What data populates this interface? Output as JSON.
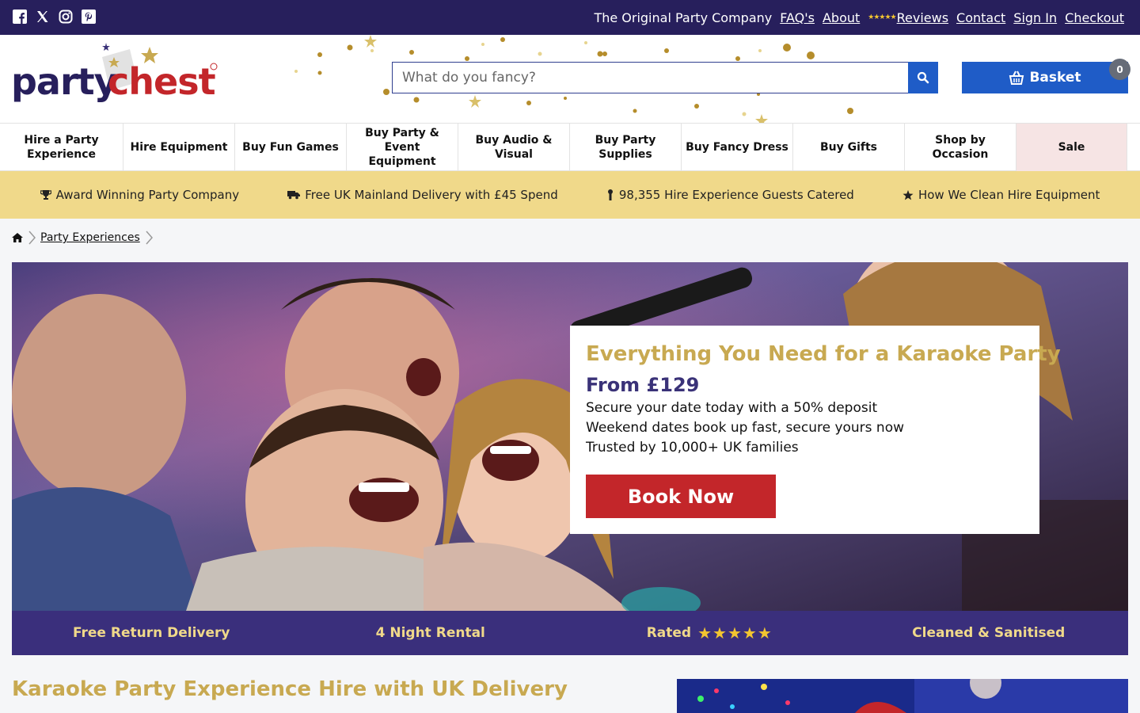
{
  "topbar": {
    "tagline": "The Original Party Company",
    "links": [
      "FAQ's",
      "About",
      "Reviews",
      "Contact",
      "Sign In",
      "Checkout"
    ],
    "stars": "★★★★★"
  },
  "header": {
    "logo_text_1": "party",
    "logo_text_2": "chest",
    "search_placeholder": "What do you fancy?",
    "basket_label": "Basket",
    "basket_count": "0"
  },
  "nav": [
    "Hire a Party Experience",
    "Hire Equipment",
    "Buy Fun Games",
    "Buy Party & Event Equipment",
    "Buy Audio & Visual",
    "Buy Party Supplies",
    "Buy Fancy Dress",
    "Buy Gifts",
    "Shop by Occasion",
    "Sale"
  ],
  "benefits": [
    "Award Winning Party Company",
    "Free UK Mainland Delivery with £45 Spend",
    "98,355 Hire Experience Guests Catered",
    "How We Clean Hire Equipment"
  ],
  "breadcrumb": {
    "current": "Party Experiences"
  },
  "hero": {
    "title": "Everything You Need for a Karaoke Party",
    "price": "From £129",
    "lines": [
      "Secure your date today with a 50% deposit",
      "Weekend dates book up fast, secure yours now",
      "Trusted by 10,000+ UK families"
    ],
    "cta": "Book Now"
  },
  "usp": {
    "items": [
      "Free Return Delivery",
      "4 Night Rental",
      "Rated",
      "Cleaned & Sanitised"
    ],
    "stars": "★★★★★"
  },
  "page": {
    "heading": "Karaoke Party Experience Hire with UK Delivery"
  },
  "colors": {
    "navy": "#271f5c",
    "gold": "#c8a951",
    "blue": "#1f5cc7",
    "red": "#c3262a",
    "strip": "#f0d98a"
  }
}
